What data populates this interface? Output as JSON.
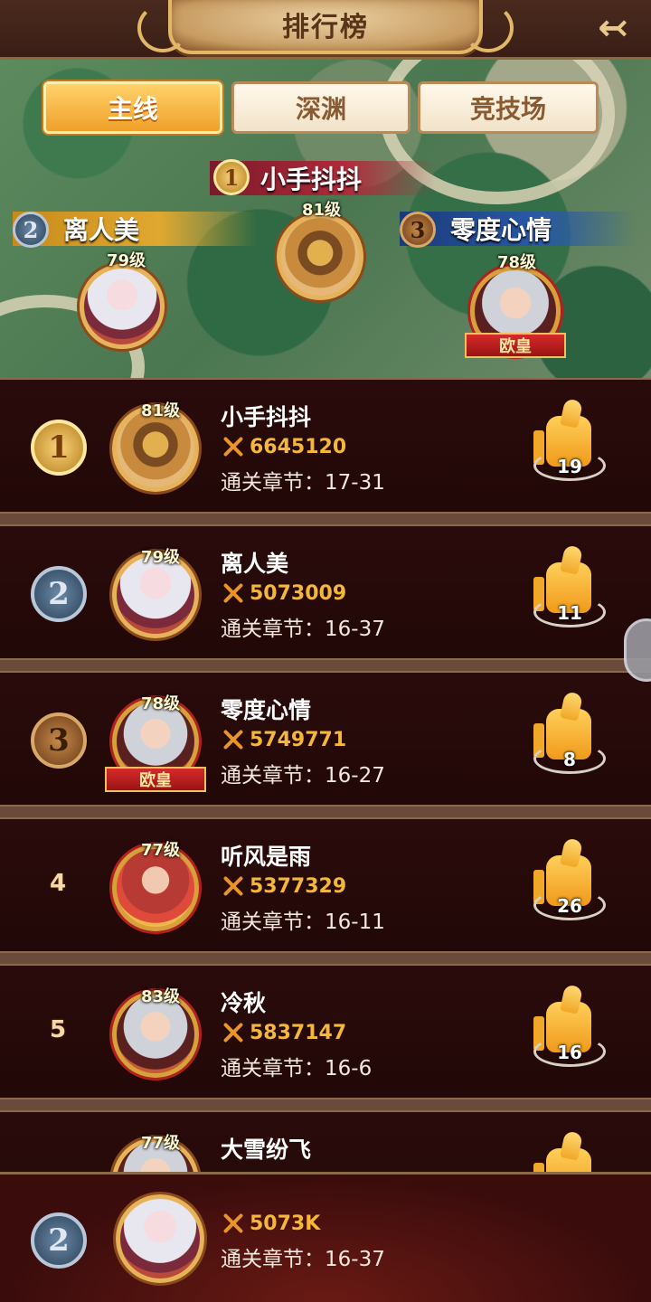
{
  "header": {
    "title": "排行榜",
    "back_icon": "↢"
  },
  "tabs": [
    {
      "label": "主线",
      "active": true
    },
    {
      "label": "深渊",
      "active": false
    },
    {
      "label": "竞技场",
      "active": false
    }
  ],
  "podium": [
    {
      "rank": "1",
      "name": "小手抖抖",
      "level": "81级"
    },
    {
      "rank": "2",
      "name": "离人美",
      "level": "79级"
    },
    {
      "rank": "3",
      "name": "零度心情",
      "level": "78级",
      "title_badge": "欧皇"
    }
  ],
  "chapter_prefix": "通关章节：",
  "rows": [
    {
      "rank": "1",
      "name": "小手抖抖",
      "level": "81级",
      "power": "6645120",
      "chapter": "通关章节：17-31",
      "likes": "19"
    },
    {
      "rank": "2",
      "name": "离人美",
      "level": "79级",
      "power": "5073009",
      "chapter": "通关章节：16-37",
      "likes": "11"
    },
    {
      "rank": "3",
      "name": "零度心情",
      "level": "78级",
      "power": "5749771",
      "chapter": "通关章节：16-27",
      "likes": "8",
      "title_badge": "欧皇"
    },
    {
      "rank": "4",
      "name": "听风是雨",
      "level": "77级",
      "power": "5377329",
      "chapter": "通关章节：16-11",
      "likes": "26"
    },
    {
      "rank": "5",
      "name": "冷秋",
      "level": "83级",
      "power": "5837147",
      "chapter": "通关章节：16-6",
      "likes": "16"
    },
    {
      "rank": "",
      "name": "大雪纷飞",
      "level": "77级",
      "power": "",
      "chapter": "",
      "likes": ""
    }
  ],
  "my_rank": {
    "rank": "2",
    "power": "5073K",
    "chapter": "通关章节：16-37"
  },
  "colors": {
    "accent_gold": "#f4b73a",
    "row_bg": "#2a0b0b",
    "tab_active": "#f0a02a"
  }
}
